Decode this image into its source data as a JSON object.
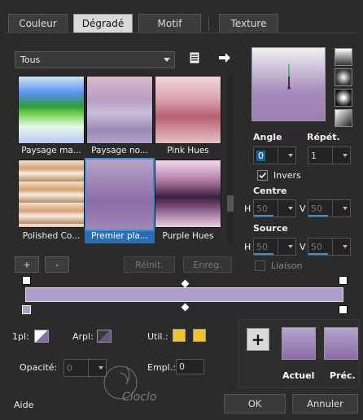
{
  "tabs": [
    {
      "label": "Couleur"
    },
    {
      "label": "Dégradé"
    },
    {
      "label": "Motif"
    },
    {
      "label": "Texture"
    }
  ],
  "category_select": {
    "value": "Tous"
  },
  "gradients": [
    {
      "label": "Paysage ma...",
      "selected": false
    },
    {
      "label": "Paysage no...",
      "selected": false
    },
    {
      "label": "Pink Hues",
      "selected": false
    },
    {
      "label": "Polished Co...",
      "selected": false
    },
    {
      "label": "Premier pla...",
      "selected": true
    },
    {
      "label": "Purple Hues",
      "selected": false
    }
  ],
  "list_buttons": {
    "add": "+",
    "remove": "-",
    "reset": "Réinit.",
    "save": "Enreg."
  },
  "angle": {
    "label": "Angle",
    "value": "0"
  },
  "repeat": {
    "label": "Répét.",
    "value": "1"
  },
  "invert": {
    "label": "Invers",
    "checked": true
  },
  "center": {
    "label": "Centre",
    "h_label": "H",
    "h_value": "50",
    "v_label": "V",
    "v_value": "50"
  },
  "source": {
    "label": "Source",
    "h_label": "H",
    "h_value": "50",
    "v_label": "V",
    "v_value": "50"
  },
  "link": {
    "label": "Liaison",
    "checked": false
  },
  "stops": {
    "first_label": "1pl:",
    "back_label": "Arpl:",
    "util_label": "Util.:",
    "opacity_label": "Opacité:",
    "opacity_value": "0",
    "location_label": "Empl.:",
    "location_value": "0",
    "util_color": "#f2c32a"
  },
  "swatches": {
    "current_label": "Actuel",
    "previous_label": "Préc."
  },
  "footer": {
    "help": "Aide",
    "ok": "OK",
    "cancel": "Annuler"
  },
  "colors": {
    "accent": "#3a8fd8",
    "gradient_light": "#b29ccb",
    "gradient_dark": "#8b6da5"
  }
}
